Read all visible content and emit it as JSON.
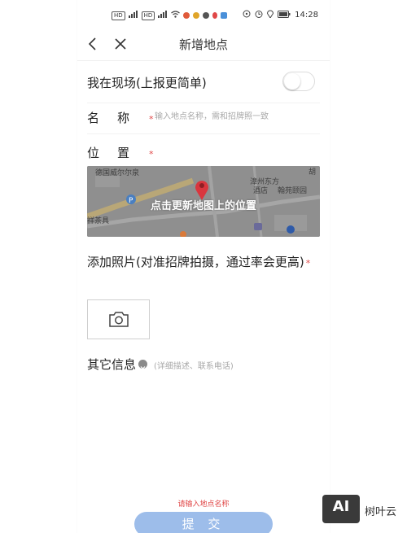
{
  "status_bar": {
    "left_chips": [
      "HD",
      "HD"
    ],
    "time": "14:28"
  },
  "header": {
    "title": "新增地点"
  },
  "form": {
    "live_label": "我在现场(上报更简单)",
    "name_label": "名称",
    "name_placeholder": "输入地点名称，需和招牌照一致",
    "location_label": "位置",
    "map_overlay": "点击更新地图上的位置",
    "map_labels": [
      "德国威尔尔泉",
      "漳州东方",
      "酒店",
      "翰苑颐园",
      "祥茶具",
      "胡"
    ],
    "photo_label": "添加照片(对准招牌拍摄，通过率会更高)",
    "other_label": "其它信息",
    "other_placeholder": "(详细描述、联系电话)",
    "required_mark": "*"
  },
  "footer": {
    "error": "请输入地点名称",
    "submit": "提 交"
  },
  "watermark": {
    "logo": "AI",
    "text": "树叶云"
  },
  "colors": {
    "required": "#e04848",
    "submit_bg": "#9dbdea",
    "map_bg": "#8f8f8f",
    "pin": "#d9363e"
  }
}
